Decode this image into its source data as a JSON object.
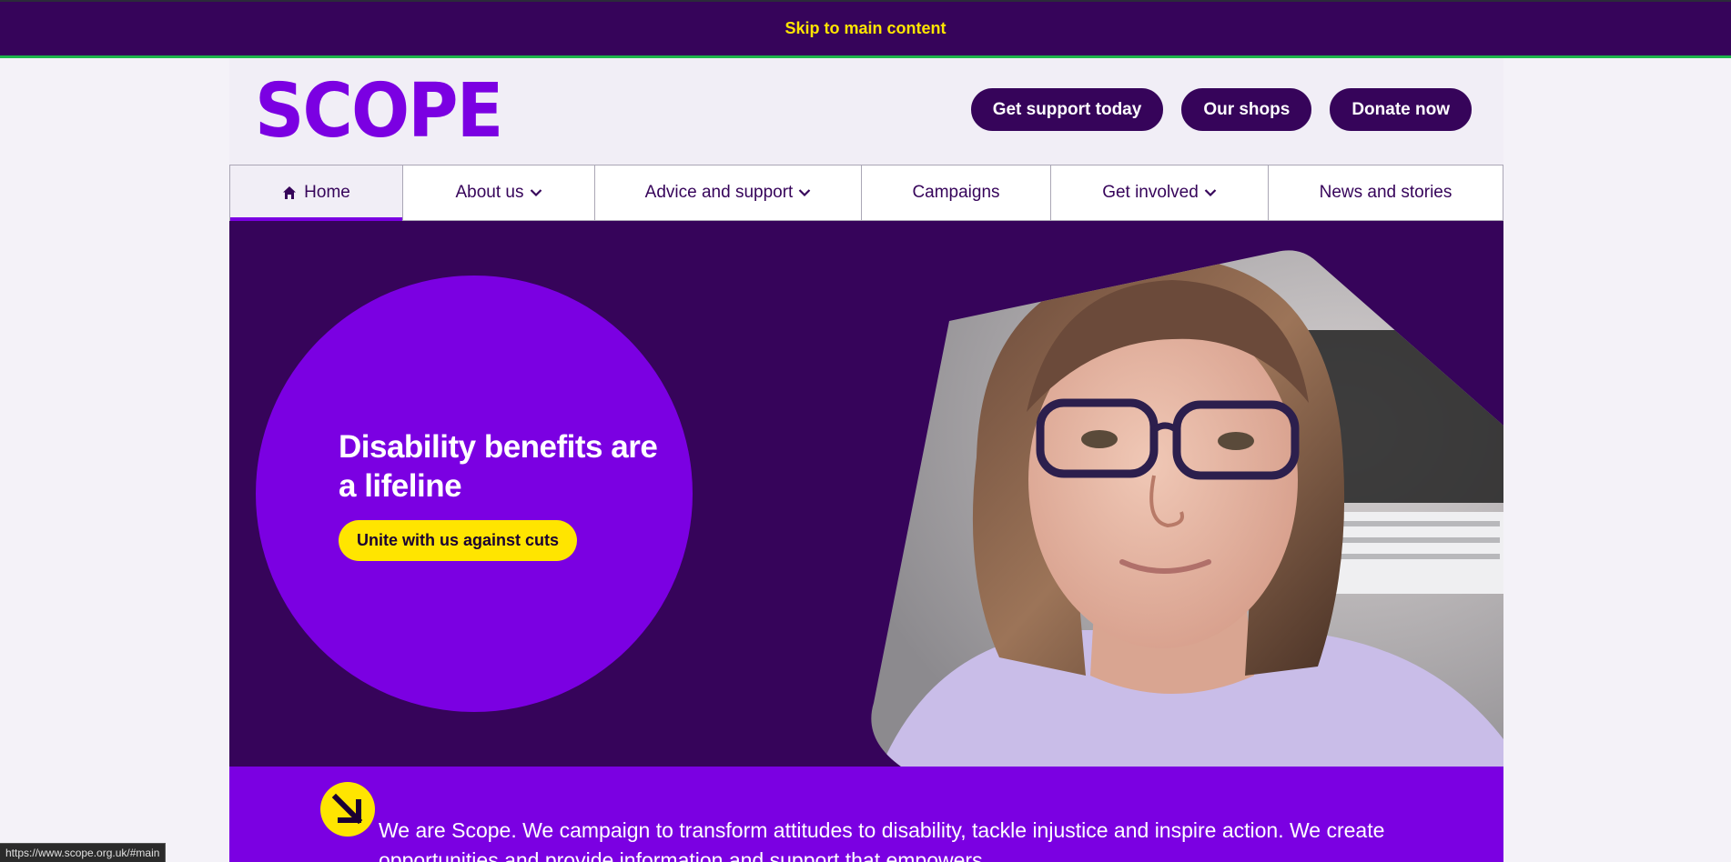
{
  "skip_link": {
    "label": "Skip to main content"
  },
  "header": {
    "logo_text": "SCOPE",
    "buttons": [
      {
        "label": "Get support today"
      },
      {
        "label": "Our shops"
      },
      {
        "label": "Donate now"
      }
    ]
  },
  "nav": {
    "items": [
      {
        "label": "Home",
        "icon": "home-icon",
        "active": true
      },
      {
        "label": "About us",
        "icon": "chevron-down-icon"
      },
      {
        "label": "Advice and support",
        "icon": "chevron-down-icon"
      },
      {
        "label": "Campaigns"
      },
      {
        "label": "Get involved",
        "icon": "chevron-down-icon"
      },
      {
        "label": "News and stories"
      }
    ]
  },
  "hero": {
    "title": "Disability benefits are a lifeline",
    "cta_label": "Unite with us against cuts"
  },
  "intro": {
    "icon": "arrow-down-right-icon",
    "text": "We are Scope. We campaign to transform attitudes to disability, tackle injustice and inspire action. We create opportunities and provide information and support that empowers"
  },
  "status_bar": {
    "url": "https://www.scope.org.uk/#main"
  },
  "colors": {
    "brand_purple": "#7b00e2",
    "dark_purple": "#36045a",
    "yellow": "#ffe500",
    "skip_bar_accent": "#1db54b"
  }
}
